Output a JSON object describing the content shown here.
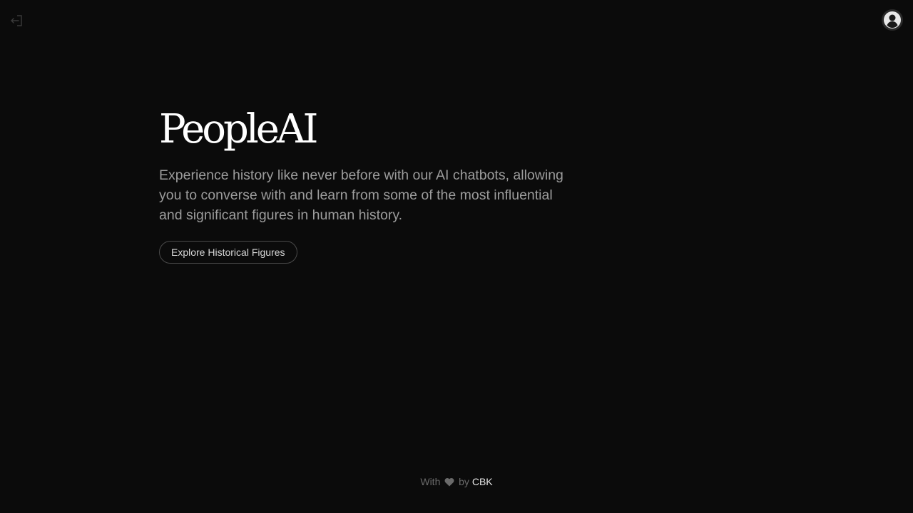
{
  "header": {
    "logout_icon": "logout-arrow-icon",
    "avatar_icon": "user-circle-icon"
  },
  "hero": {
    "title": "PeopleAI",
    "description": "Experience history like never before with our AI chatbots, allowing you to converse with and learn from some of the most influential and significant figures in human history.",
    "cta_label": "Explore Historical Figures"
  },
  "footer": {
    "prefix": "With",
    "heart_icon": "heart-icon",
    "middle": "by",
    "author": "CBK"
  },
  "colors": {
    "background": "#0b0b0b",
    "title": "#ffffff",
    "description": "#9c9c9c",
    "muted": "#6a6a6a"
  }
}
